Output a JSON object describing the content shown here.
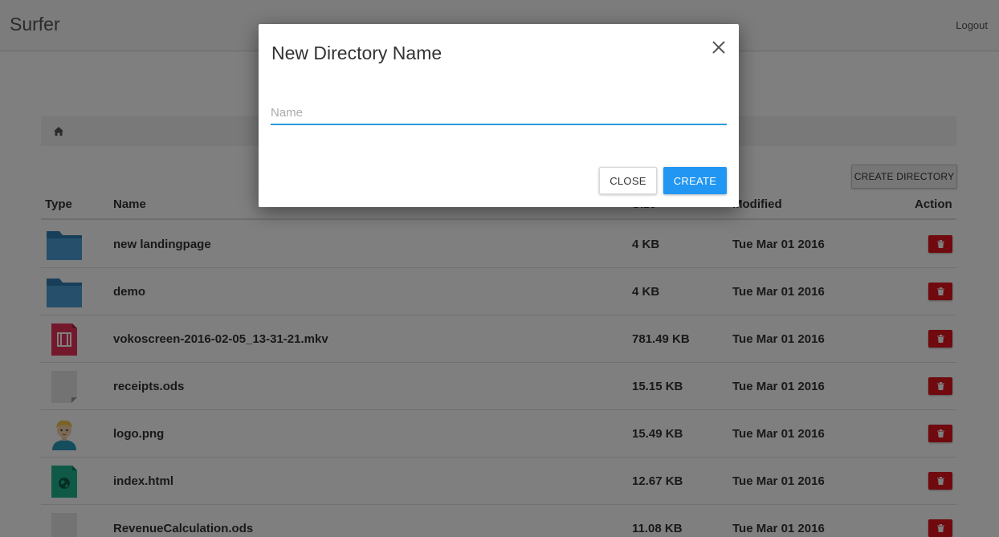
{
  "app": {
    "brand": "Surfer",
    "logout_label": "Logout"
  },
  "toolbar": {
    "create_directory_label": "CREATE DIRECTORY"
  },
  "table": {
    "headers": {
      "type": "Type",
      "name": "Name",
      "size": "Size",
      "modified": "Modified",
      "action": "Action"
    },
    "rows": [
      {
        "type_icon": "folder-icon",
        "name": "new landingpage",
        "size": "4 KB",
        "modified": "Tue Mar 01 2016"
      },
      {
        "type_icon": "folder-icon",
        "name": "demo",
        "size": "4 KB",
        "modified": "Tue Mar 01 2016"
      },
      {
        "type_icon": "video-file-icon",
        "name": "vokoscreen-2016-02-05_13-31-21.mkv",
        "size": "781.49 KB",
        "modified": "Tue Mar 01 2016"
      },
      {
        "type_icon": "generic-file-icon",
        "name": "receipts.ods",
        "size": "15.15 KB",
        "modified": "Tue Mar 01 2016"
      },
      {
        "type_icon": "image-thumbnail-icon",
        "name": "logo.png",
        "size": "15.49 KB",
        "modified": "Tue Mar 01 2016"
      },
      {
        "type_icon": "html-file-icon",
        "name": "index.html",
        "size": "12.67 KB",
        "modified": "Tue Mar 01 2016"
      },
      {
        "type_icon": "generic-file-icon",
        "name": "RevenueCalculation.ods",
        "size": "11.08 KB",
        "modified": "Tue Mar 01 2016"
      }
    ]
  },
  "modal": {
    "title": "New Directory Name",
    "input_placeholder": "Name",
    "input_value": "",
    "close_label": "CLOSE",
    "create_label": "CREATE"
  },
  "colors": {
    "accent": "#2196f3",
    "danger": "#e0141e",
    "folder": "#3e8fc4",
    "video": "#d8304d",
    "html": "#1a9a7a"
  }
}
